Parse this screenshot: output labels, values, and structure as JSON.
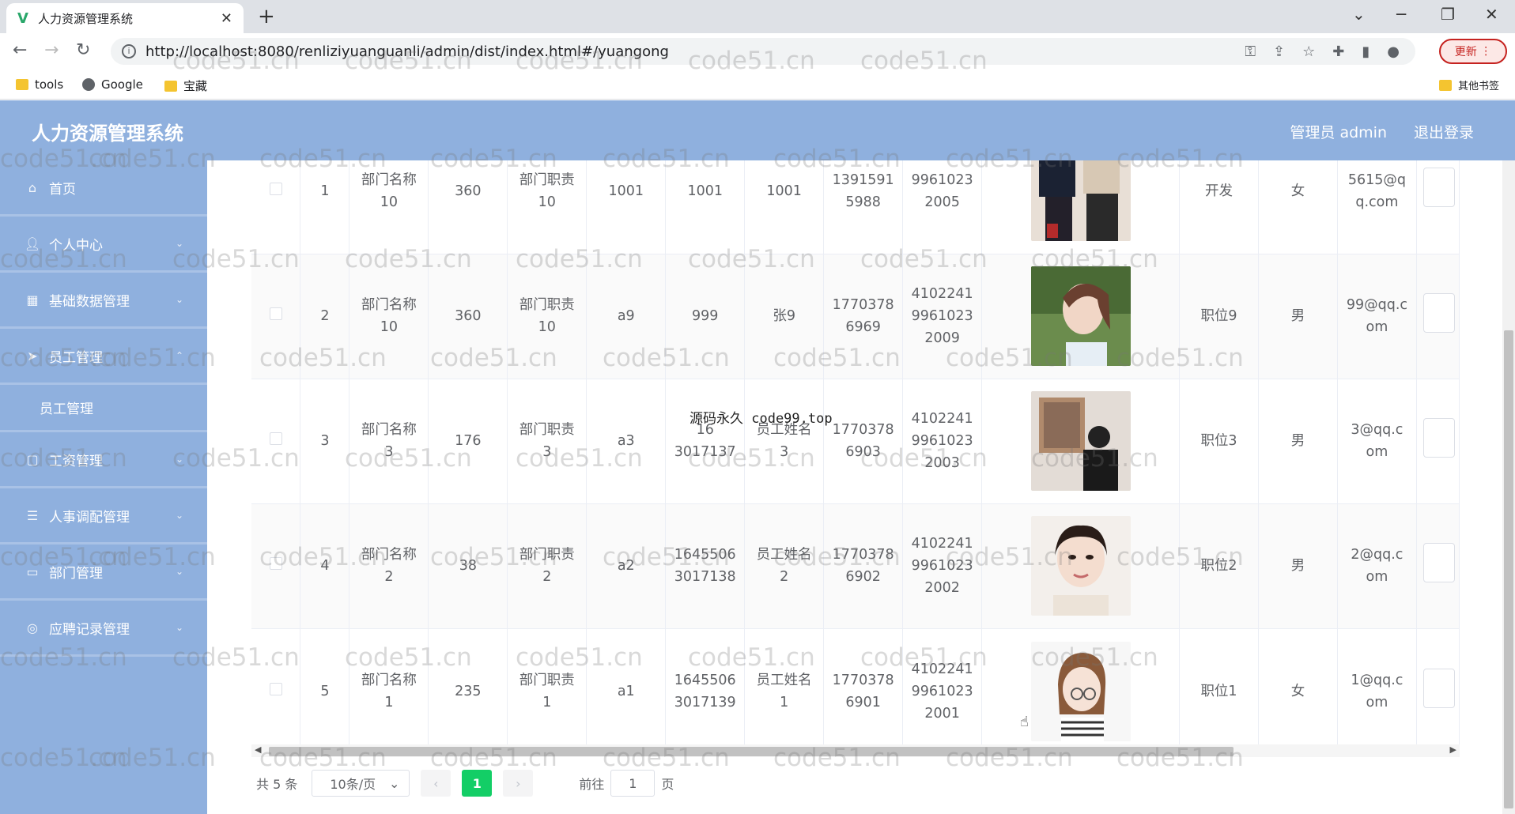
{
  "browser": {
    "tab_title": "人力资源管理系统",
    "url": "http://localhost:8080/renliziyuanguanli/admin/dist/index.html#/yuangong",
    "update_label": "更新",
    "bookmarks": [
      "tools",
      "Google",
      "宝藏"
    ],
    "other_bookmarks": "其他书签"
  },
  "header": {
    "title": "人力资源管理系统",
    "user_label": "管理员 admin",
    "logout_label": "退出登录"
  },
  "sidebar": {
    "items": [
      {
        "label": "首页",
        "icon": "home-icon"
      },
      {
        "label": "个人中心",
        "icon": "user-icon"
      },
      {
        "label": "基础数据管理",
        "icon": "grid-icon"
      },
      {
        "label": "员工管理",
        "icon": "send-icon"
      },
      {
        "label": "员工管理",
        "icon": ""
      },
      {
        "label": "工资管理",
        "icon": "document-icon"
      },
      {
        "label": "人事调配管理",
        "icon": "list-icon"
      },
      {
        "label": "部门管理",
        "icon": "monitor-icon"
      },
      {
        "label": "应聘记录管理",
        "icon": "circle-icon"
      }
    ]
  },
  "table": {
    "rows": [
      {
        "index": "1",
        "dept_name": "部门名称\n10",
        "v1": "360",
        "dept_duty": "部门职责\n10",
        "account": "1001",
        "emp_no": "1001",
        "emp_name": "1001",
        "phone": "1391591\n5988",
        "id_card": "9961023\n2005",
        "position": "开发",
        "gender": "女",
        "email": "5615@q\nq.com"
      },
      {
        "index": "2",
        "dept_name": "部门名称\n10",
        "v1": "360",
        "dept_duty": "部门职责\n10",
        "account": "a9",
        "emp_no": "999",
        "emp_name": "张9",
        "phone": "1770378\n6969",
        "id_card": "4102241\n9961023\n2009",
        "position": "职位9",
        "gender": "男",
        "email": "99@qq.c\nom"
      },
      {
        "index": "3",
        "dept_name": "部门名称\n3",
        "v1": "176",
        "dept_duty": "部门职责\n3",
        "account": "a3",
        "emp_no": "16\n3017137",
        "emp_name": "员工姓名\n3",
        "phone": "1770378\n6903",
        "id_card": "4102241\n9961023\n2003",
        "position": "职位3",
        "gender": "男",
        "email": "3@qq.c\nom"
      },
      {
        "index": "4",
        "dept_name": "部门名称\n2",
        "v1": "38",
        "dept_duty": "部门职责\n2",
        "account": "a2",
        "emp_no": "1645506\n3017138",
        "emp_name": "员工姓名\n2",
        "phone": "1770378\n6902",
        "id_card": "4102241\n9961023\n2002",
        "position": "职位2",
        "gender": "男",
        "email": "2@qq.c\nom"
      },
      {
        "index": "5",
        "dept_name": "部门名称\n1",
        "v1": "235",
        "dept_duty": "部门职责\n1",
        "account": "a1",
        "emp_no": "1645506\n3017139",
        "emp_name": "员工姓名\n1",
        "phone": "1770378\n6901",
        "id_card": "4102241\n9961023\n2001",
        "position": "职位1",
        "gender": "女",
        "email": "1@qq.c\nom"
      }
    ]
  },
  "pagination": {
    "total": "共 5 条",
    "page_size": "10条/页",
    "current": "1",
    "goto_label": "前往",
    "goto_value": "1",
    "page_unit": "页"
  },
  "overlay_text": "源码永久 code99.top",
  "watermark": "code51.cn",
  "watermark_short": "cn",
  "watermark_cod": "cod",
  "colors": {
    "header_bg": "#8fb0de",
    "accent": "#13ce66"
  }
}
